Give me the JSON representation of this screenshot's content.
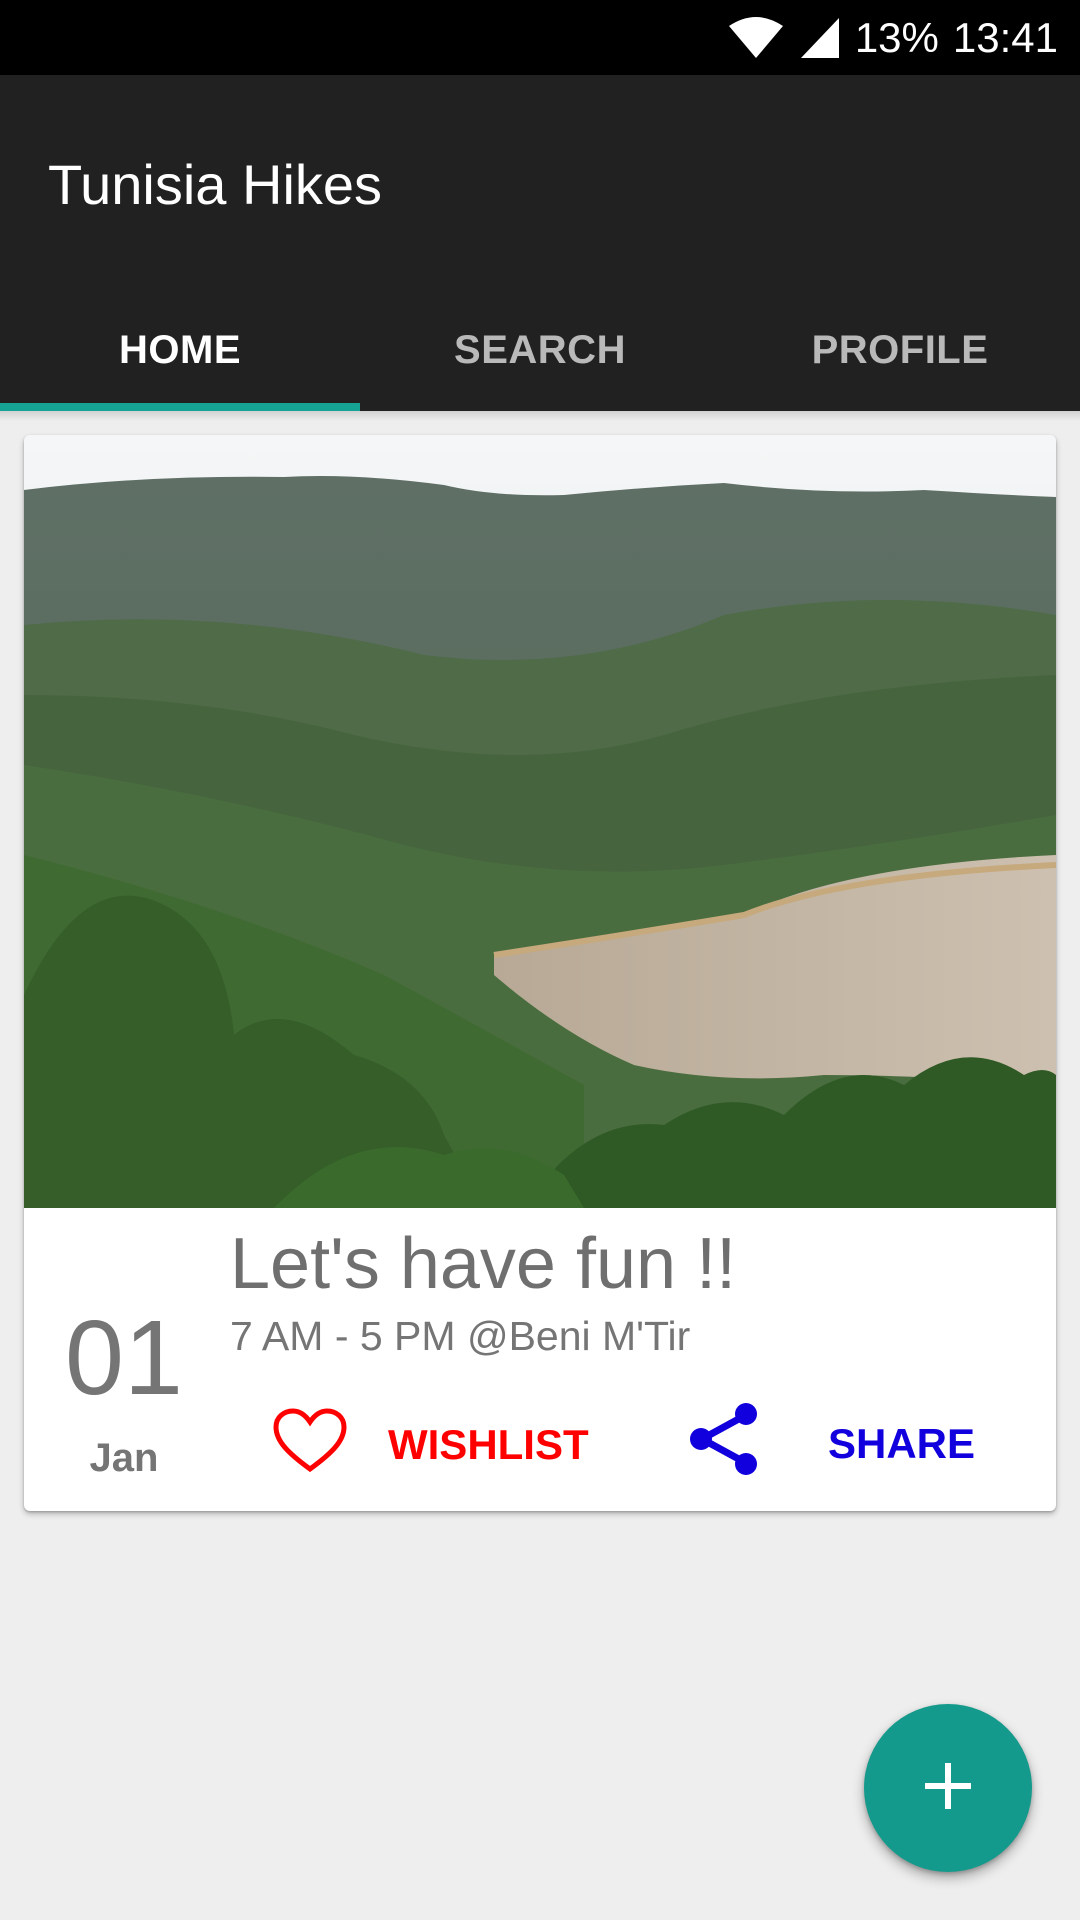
{
  "status_bar": {
    "battery": "13%",
    "time": "13:41",
    "icons": [
      "wifi-icon",
      "cellular-signal-icon"
    ]
  },
  "app_bar": {
    "title": "Tunisia Hikes"
  },
  "tabs": [
    {
      "label": "HOME",
      "active": true
    },
    {
      "label": "SEARCH",
      "active": false
    },
    {
      "label": "PROFILE",
      "active": false
    }
  ],
  "event_card": {
    "day": "01",
    "month": "Jan",
    "title": "Let's have fun !!",
    "details": "7 AM - 5 PM @Beni M'Tir",
    "wishlist_label": "WISHLIST",
    "share_label": "SHARE"
  },
  "fab": {
    "icon": "plus-icon"
  },
  "colors": {
    "status_bar": "#000000",
    "app_bar": "#212121",
    "accent": "#17a296",
    "fab": "#139a8c",
    "wishlist": "#ff0000",
    "share": "#1100dd",
    "background": "#eeeeee"
  }
}
